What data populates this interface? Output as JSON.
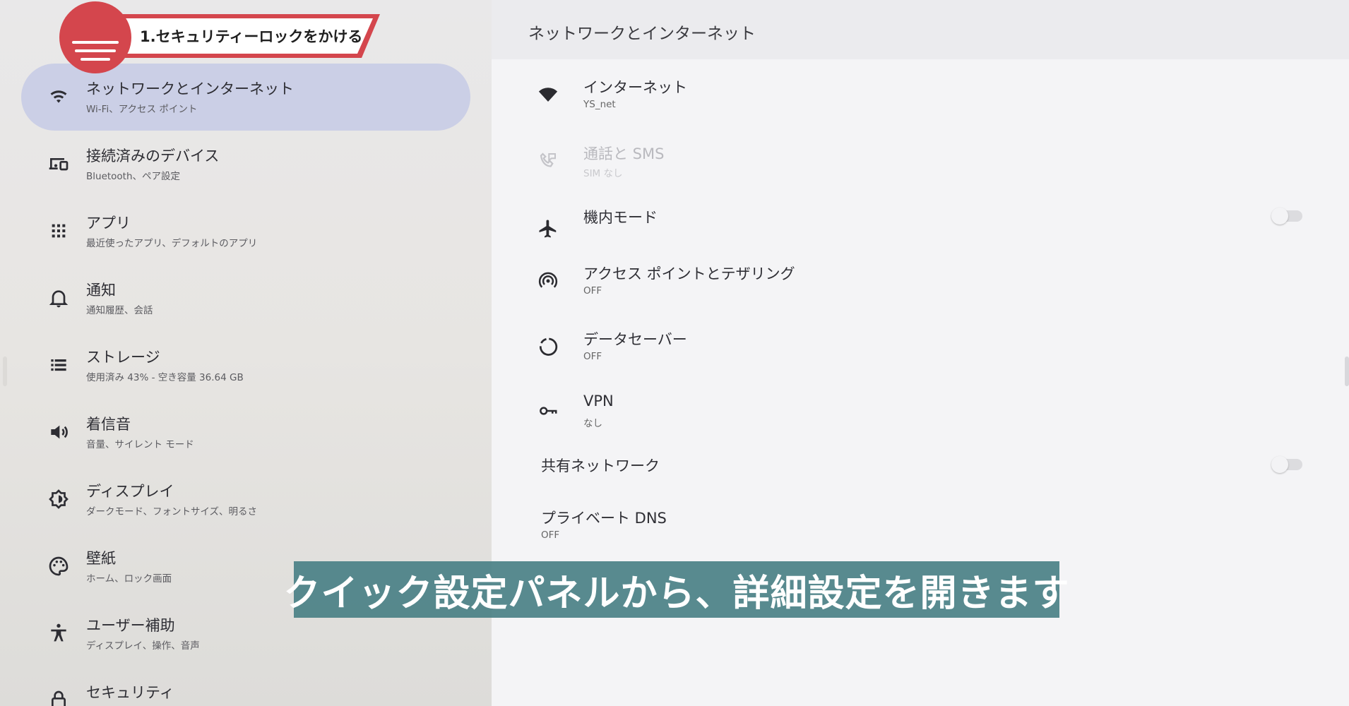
{
  "badge": {
    "text": "1.セキュリティーロックをかける",
    "color": "#d4464d"
  },
  "nav": {
    "items": [
      {
        "title": "ネットワークとインターネット",
        "subtitle": "Wi-Fi、アクセス ポイント",
        "icon": "wifi-icon",
        "active": true
      },
      {
        "title": "接続済みのデバイス",
        "subtitle": "Bluetooth、ペア設定",
        "icon": "devices-icon",
        "active": false
      },
      {
        "title": "アプリ",
        "subtitle": "最近使ったアプリ、デフォルトのアプリ",
        "icon": "apps-grid-icon",
        "active": false
      },
      {
        "title": "通知",
        "subtitle": "通知履歴、会話",
        "icon": "bell-icon",
        "active": false
      },
      {
        "title": "ストレージ",
        "subtitle": "使用済み 43% - 空き容量 36.64 GB",
        "icon": "storage-list-icon",
        "active": false
      },
      {
        "title": "着信音",
        "subtitle": "音量、サイレント モード",
        "icon": "speaker-icon",
        "active": false
      },
      {
        "title": "ディスプレイ",
        "subtitle": "ダークモード、フォントサイズ、明るさ",
        "icon": "brightness-icon",
        "active": false
      },
      {
        "title": "壁紙",
        "subtitle": "ホーム、ロック画面",
        "icon": "palette-icon",
        "active": false
      },
      {
        "title": "ユーザー補助",
        "subtitle": "ディスプレイ、操作、音声",
        "icon": "accessibility-icon",
        "active": false
      },
      {
        "title": "セキュリティ",
        "subtitle": "",
        "icon": "lock-icon",
        "active": false
      }
    ],
    "active_color": "#cbcfe6"
  },
  "right": {
    "title": "ネットワークとインターネット",
    "settings": [
      {
        "title": "インターネット",
        "subtitle": "YS_net",
        "icon": "wifi-filled-icon"
      },
      {
        "title": "通話と SMS",
        "subtitle": "SIM なし",
        "icon": "phone-sms-icon",
        "disabled": true
      },
      {
        "title": "機内モード",
        "subtitle": "",
        "icon": "airplane-icon",
        "toggle": false
      },
      {
        "title": "アクセス ポイントとテザリング",
        "subtitle": "OFF",
        "icon": "hotspot-icon"
      },
      {
        "title": "データセーバー",
        "subtitle": "OFF",
        "icon": "data-saver-icon"
      },
      {
        "title": "VPN",
        "subtitle": "なし",
        "icon": "vpn-key-icon"
      },
      {
        "title": "共有ネットワーク",
        "subtitle": "",
        "icon": "",
        "toggle": false
      },
      {
        "title": "プライベート DNS",
        "subtitle": "OFF",
        "icon": ""
      }
    ]
  },
  "caption": {
    "text": "クイック設定パネルから、詳細設定を開きます",
    "background": "#4a8086"
  }
}
